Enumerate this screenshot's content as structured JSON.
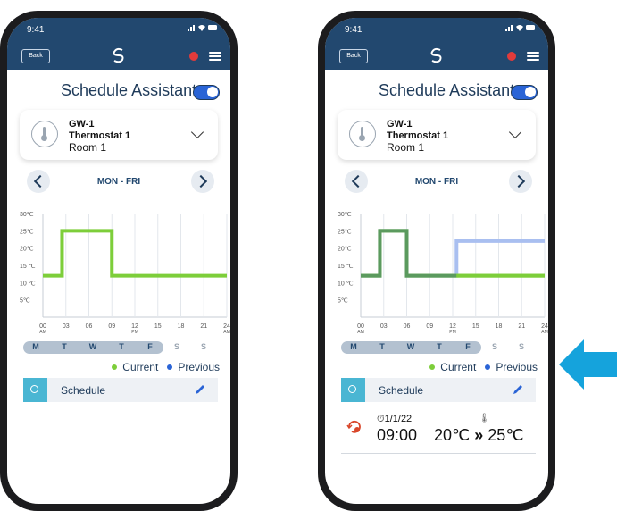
{
  "status_bar": {
    "time": "9:41"
  },
  "nav": {
    "back_label": "Back"
  },
  "header": {
    "title": "Schedule Assistant",
    "toggle_on": true
  },
  "device": {
    "gateway": "GW-1",
    "name": "Thermostat  1",
    "room": "Room 1"
  },
  "day_selector": {
    "label": "MON - FRI"
  },
  "chart_data": {
    "type": "line",
    "y_ticks": [
      "30℃",
      "25℃",
      "20℃",
      "15 ℃",
      "10 ℃",
      "5℃"
    ],
    "x_ticks": [
      {
        "label": "00",
        "sub": "AM"
      },
      {
        "label": "03",
        "sub": ""
      },
      {
        "label": "06",
        "sub": ""
      },
      {
        "label": "09",
        "sub": ""
      },
      {
        "label": "12",
        "sub": "PM"
      },
      {
        "label": "15",
        "sub": ""
      },
      {
        "label": "18",
        "sub": ""
      },
      {
        "label": "21",
        "sub": ""
      },
      {
        "label": "24",
        "sub": "AM"
      }
    ],
    "ylim": [
      0,
      30
    ],
    "xlim": [
      0,
      24
    ],
    "series": [
      {
        "name": "Current",
        "color": "#7dce3a",
        "points": [
          [
            0,
            12
          ],
          [
            2.5,
            12
          ],
          [
            2.5,
            25
          ],
          [
            9,
            25
          ],
          [
            9,
            12
          ],
          [
            24,
            12
          ]
        ]
      },
      {
        "name": "Previous",
        "color": "#a9bff0",
        "points": [
          [
            0,
            12
          ],
          [
            2.5,
            12
          ],
          [
            2.5,
            25
          ],
          [
            6,
            25
          ],
          [
            6,
            12
          ],
          [
            12.5,
            12
          ],
          [
            12.5,
            22
          ],
          [
            24,
            22
          ]
        ]
      }
    ]
  },
  "weekdays": [
    {
      "label": "M",
      "active": true
    },
    {
      "label": "T",
      "active": true
    },
    {
      "label": "W",
      "active": true
    },
    {
      "label": "T",
      "active": true
    },
    {
      "label": "F",
      "active": true
    },
    {
      "label": "S",
      "active": false
    },
    {
      "label": "S",
      "active": false
    }
  ],
  "legend": {
    "current": "Current",
    "previous": "Previous"
  },
  "schedule": {
    "label": "Schedule"
  },
  "event": {
    "date": "1/1/22",
    "time": "09:00",
    "from_temp": "20℃",
    "separator": "»",
    "to_temp": "25℃"
  },
  "colors": {
    "nav": "#22486f",
    "accent": "#2a64d6",
    "current": "#7dce3a",
    "previous": "#a9bff0",
    "arrow": "#15a3dc"
  }
}
